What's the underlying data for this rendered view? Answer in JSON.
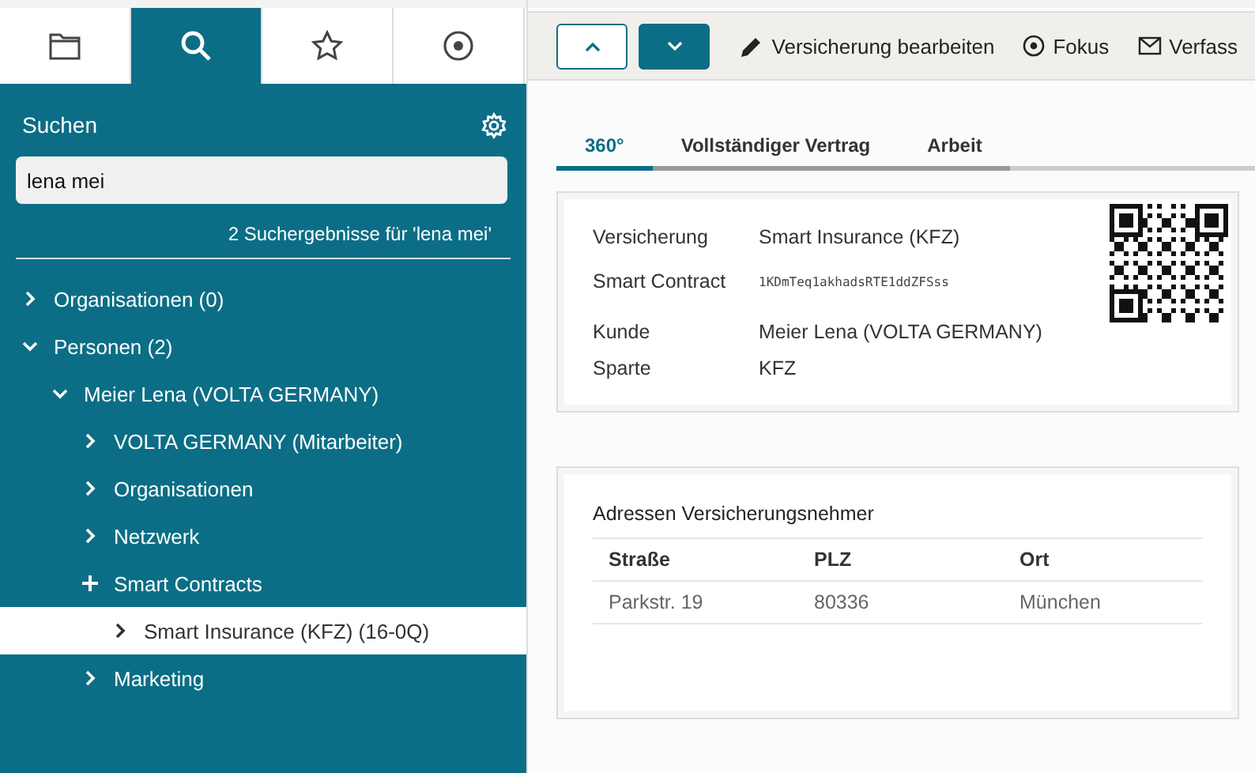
{
  "nav_tabs": [
    {
      "kind": "folder",
      "selected": false
    },
    {
      "kind": "search",
      "selected": true
    },
    {
      "kind": "star",
      "selected": false
    },
    {
      "kind": "target",
      "selected": false
    }
  ],
  "sidebar": {
    "title": "Suchen",
    "search": {
      "value": "lena mei"
    },
    "result_count": "2 Suchergebnisse für 'lena mei'",
    "tree": [
      {
        "label": "Organisationen (0)",
        "kind": "chevron",
        "expanded": false,
        "selected": false
      },
      {
        "label": "Personen (2)",
        "kind": "chevron",
        "expanded": true,
        "selected": false,
        "children": [
          {
            "label": "Meier Lena (VOLTA GERMANY)",
            "kind": "chevron",
            "expanded": true,
            "selected": false,
            "children": [
              {
                "label": "VOLTA GERMANY (Mitarbeiter)",
                "kind": "chevron",
                "expanded": false,
                "selected": false
              },
              {
                "label": "Organisationen",
                "kind": "chevron",
                "expanded": false,
                "selected": false
              },
              {
                "label": "Netzwerk",
                "kind": "chevron",
                "expanded": false,
                "selected": false
              },
              {
                "label": "Smart Contracts",
                "kind": "plus",
                "expanded": true,
                "selected": false,
                "children": [
                  {
                    "label": "Smart Insurance (KFZ) (16-0Q)",
                    "kind": "chevron",
                    "expanded": false,
                    "selected": true
                  }
                ]
              },
              {
                "label": "Marketing",
                "kind": "chevron",
                "expanded": false,
                "selected": false
              }
            ]
          }
        ]
      }
    ]
  },
  "toolbar": {
    "actions": [
      {
        "kind": "edit",
        "label": "Versicherung bearbeiten"
      },
      {
        "kind": "focus",
        "label": "Fokus"
      },
      {
        "kind": "compose",
        "label": "Verfass"
      }
    ]
  },
  "tabs": [
    {
      "label": "360°",
      "selected": true
    },
    {
      "label": "Vollständiger Vertrag",
      "selected": false
    },
    {
      "label": "Arbeit",
      "selected": false
    }
  ],
  "details": [
    {
      "label": "Versicherung",
      "value": "Smart Insurance (KFZ)",
      "kind": "text"
    },
    {
      "label": "Smart Contract",
      "value": "1KDmTeq1akhadsRTE1ddZFSss",
      "kind": "code"
    },
    {
      "label": "Kunde",
      "value": "Meier Lena (VOLTA GERMANY)",
      "kind": "text"
    },
    {
      "label": "Sparte",
      "value": "KFZ",
      "kind": "text"
    }
  ],
  "addresses": {
    "title": "Adressen Versicherungsnehmer",
    "columns": [
      "Straße",
      "PLZ",
      "Ort"
    ],
    "rows": [
      [
        "Parkstr. 19",
        "80336",
        "München"
      ]
    ]
  }
}
